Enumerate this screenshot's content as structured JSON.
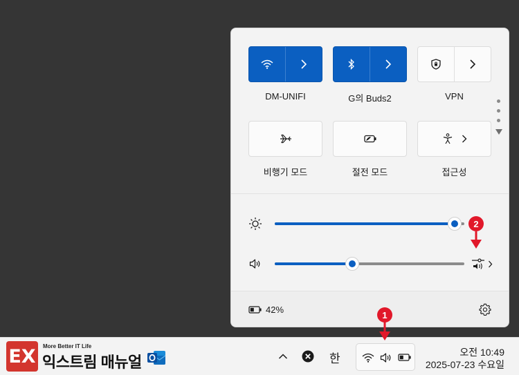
{
  "quick_settings": {
    "tiles": [
      {
        "label": "DM-UNIFI",
        "state": "on",
        "icon": "wifi-icon"
      },
      {
        "label": "G의 Buds2",
        "state": "on",
        "icon": "bluetooth-icon"
      },
      {
        "label": "VPN",
        "state": "off",
        "icon": "shield-icon"
      },
      {
        "label": "비행기 모드",
        "state": "off",
        "icon": "airplane-icon"
      },
      {
        "label": "절전 모드",
        "state": "off",
        "icon": "battery-saver-icon"
      },
      {
        "label": "접근성",
        "state": "off",
        "icon": "accessibility-icon"
      }
    ],
    "brightness": {
      "value": 95,
      "icon": "brightness-icon"
    },
    "volume": {
      "value": 41,
      "icon": "speaker-icon"
    },
    "battery_percent": "42%"
  },
  "taskbar": {
    "logo_mark": "EX",
    "logo_tagline": "More Better IT Life",
    "logo_name": "익스트림 매뉴얼",
    "ime_label": "한",
    "clock_time": "오전 10:49",
    "clock_date": "2025-07-23 수요일"
  },
  "annotations": {
    "marker_1": "1",
    "marker_2": "2"
  },
  "colors": {
    "accent": "#0b5fc1",
    "marker": "#e1182a"
  }
}
